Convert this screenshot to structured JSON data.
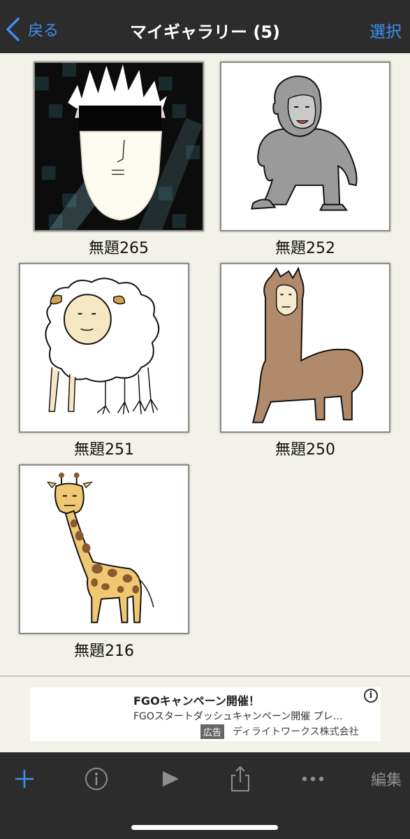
{
  "nav": {
    "back_label": "戻る",
    "title": "マイギャラリー (5)",
    "select_label": "選択"
  },
  "gallery": {
    "items": [
      {
        "title": "無題265",
        "subject": "spiky-haired-man"
      },
      {
        "title": "無題252",
        "subject": "gorilla"
      },
      {
        "title": "無題251",
        "subject": "sheep"
      },
      {
        "title": "無題250",
        "subject": "alpaca"
      },
      {
        "title": "無題216",
        "subject": "giraffe"
      }
    ]
  },
  "ad": {
    "headline": "FGOキャンペーン開催！",
    "body": "FGOスタートダッシュキャンペーン開催 プレ…",
    "badge": "広告",
    "advertiser": "ディライトワークス株式会社",
    "info_icon": "i"
  },
  "toolbar": {
    "add_icon": "plus-icon",
    "info_icon": "info-icon",
    "play_icon": "play-icon",
    "share_icon": "share-icon",
    "more_icon": "more-icon",
    "edit_label": "編集"
  },
  "colors": {
    "accent": "#3d8ff0",
    "bar_bg": "#2c2c2c",
    "page_bg": "#f2f1ea",
    "disabled": "#8f8f8f"
  }
}
